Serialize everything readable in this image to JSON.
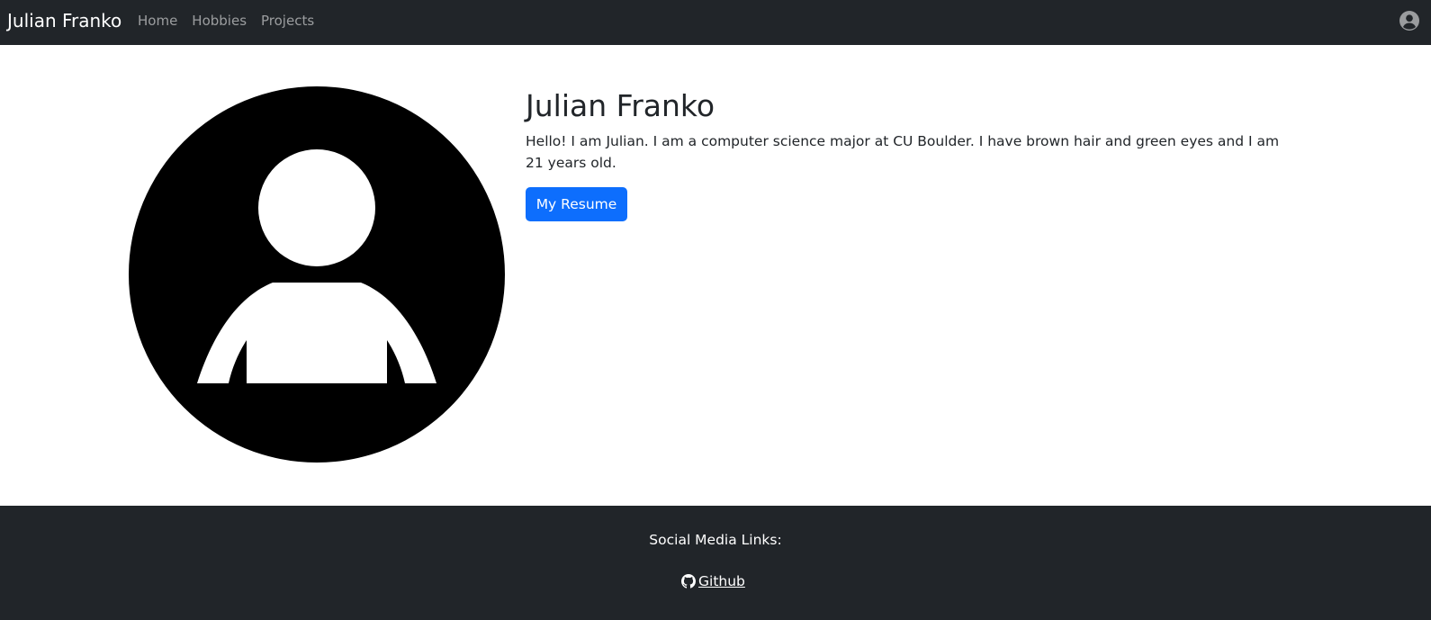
{
  "navbar": {
    "brand": "Julian Franko",
    "links": [
      {
        "label": "Home"
      },
      {
        "label": "Hobbies"
      },
      {
        "label": "Projects"
      }
    ],
    "account_icon": "person-circle-icon"
  },
  "profile": {
    "avatar_icon": "person-avatar-icon",
    "name": "Julian Franko",
    "bio": "Hello! I am Julian. I am a computer science major at CU Boulder. I have brown hair and green eyes and I am 21 years old.",
    "resume_button_label": "My Resume"
  },
  "footer": {
    "heading": "Social Media Links:",
    "github_icon": "github-icon",
    "github_label": " Github"
  },
  "colors": {
    "navbar_bg": "#212529",
    "footer_bg": "#212529",
    "button_bg": "#0d6efd",
    "nav_link": "rgba(255,255,255,0.55)"
  }
}
